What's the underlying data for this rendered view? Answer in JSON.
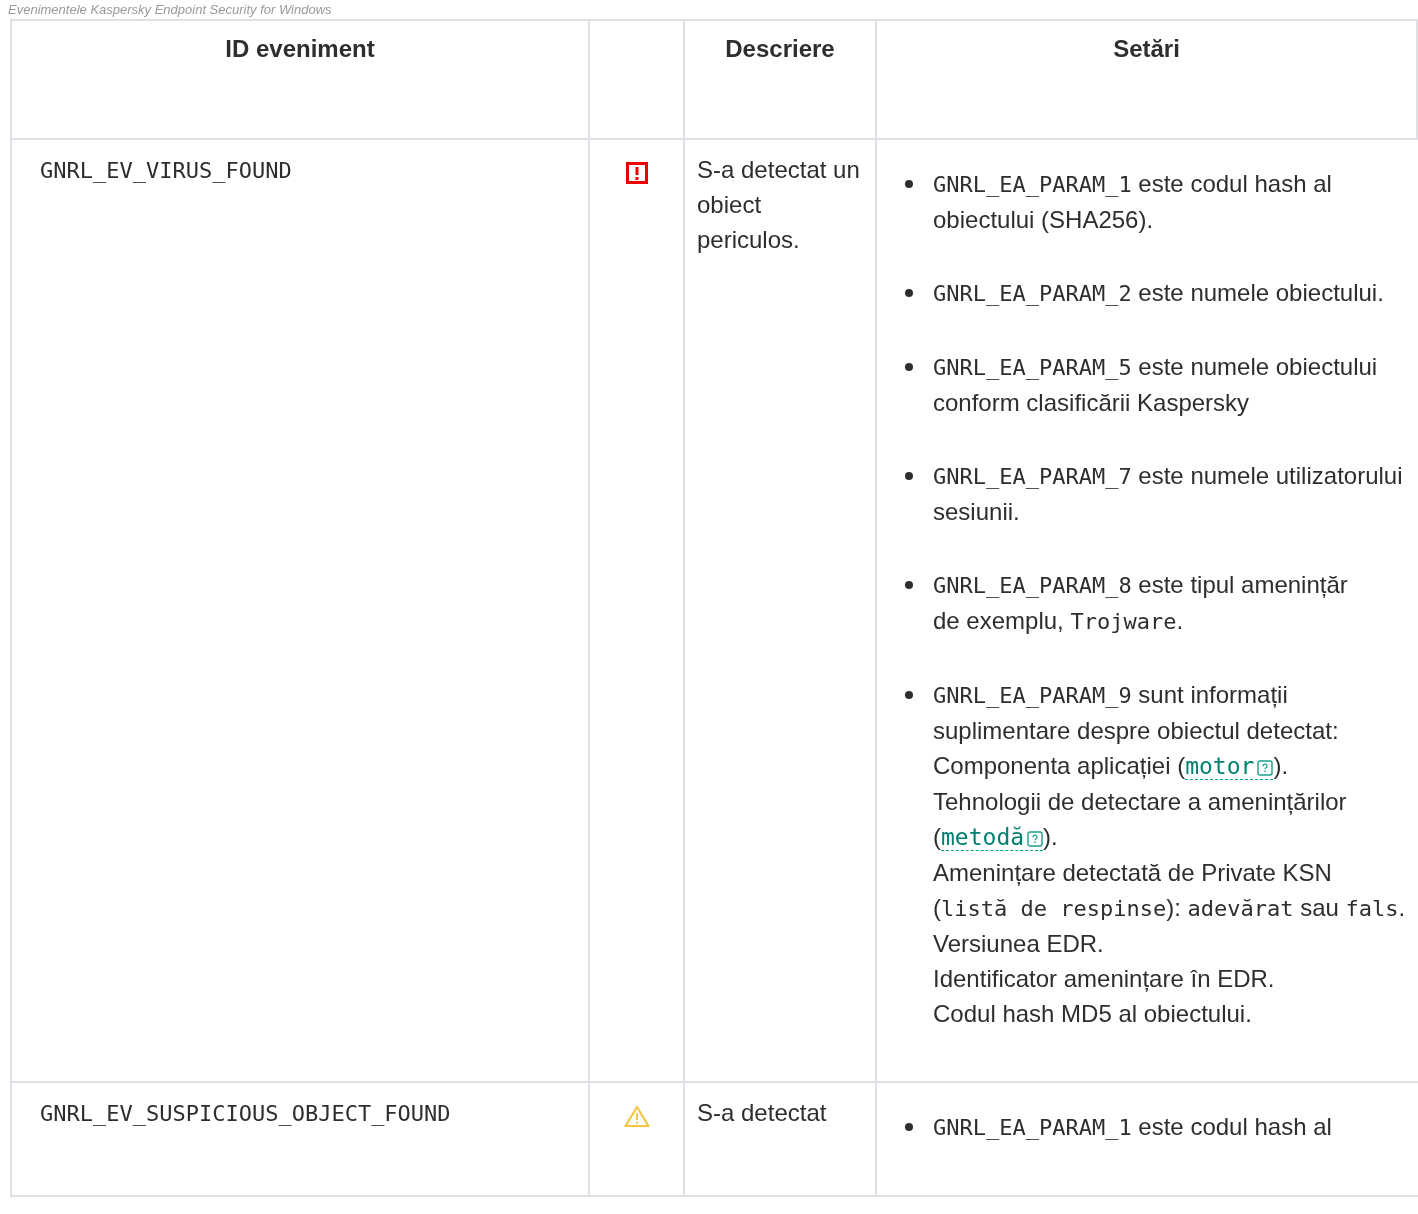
{
  "caption": "Evenimentele Kaspersky Endpoint Security for Windows",
  "table": {
    "columns": [
      "ID eveniment",
      "",
      "Descriere",
      "Setări"
    ],
    "rows": [
      {
        "id": "GNRL_EV_VIRUS_FOUND",
        "kind": "error",
        "description": "S-a detectat un obiect periculos.",
        "settings": [
          [
            {
              "kind": "code",
              "text": "GNRL_EA_PARAM_1"
            },
            {
              "kind": "text",
              "text": " este codul hash al obiectului (SHA256)."
            }
          ],
          [
            {
              "kind": "code",
              "text": "GNRL_EA_PARAM_2"
            },
            {
              "kind": "text",
              "text": " este numele obiectului."
            }
          ],
          [
            {
              "kind": "code",
              "text": "GNRL_EA_PARAM_5"
            },
            {
              "kind": "text",
              "text": " este numele obiectului conform clasificării Kaspersky"
            }
          ],
          [
            {
              "kind": "code",
              "text": "GNRL_EA_PARAM_7"
            },
            {
              "kind": "text",
              "text": " este numele utilizatorului sesiunii."
            }
          ],
          [
            {
              "kind": "code",
              "text": "GNRL_EA_PARAM_8"
            },
            {
              "kind": "text",
              "text": " este tipul amenințăr"
            },
            {
              "kind": "break"
            },
            {
              "kind": "text",
              "text": "de exemplu, "
            },
            {
              "kind": "code",
              "text": "Trojware"
            },
            {
              "kind": "text",
              "text": "."
            }
          ],
          [
            {
              "kind": "code",
              "text": "GNRL_EA_PARAM_9"
            },
            {
              "kind": "text",
              "text": " sunt informații suplimentare despre obiectul detectat: Componenta aplicației ("
            },
            {
              "kind": "link",
              "text": "motor"
            },
            {
              "kind": "text",
              "text": ")."
            },
            {
              "kind": "break"
            },
            {
              "kind": "text",
              "text": "Tehnologii de detectare a amenințărilor ("
            },
            {
              "kind": "link",
              "text": "metodă"
            },
            {
              "kind": "text",
              "text": ")."
            },
            {
              "kind": "break"
            },
            {
              "kind": "text",
              "text": "Amenințare detectată de Private KSN ("
            },
            {
              "kind": "code",
              "text": "listă de respinse"
            },
            {
              "kind": "text",
              "text": "): "
            },
            {
              "kind": "code",
              "text": "adevărat"
            },
            {
              "kind": "text",
              "text": " sau "
            },
            {
              "kind": "code",
              "text": "fals"
            },
            {
              "kind": "text",
              "text": "."
            },
            {
              "kind": "break"
            },
            {
              "kind": "text",
              "text": "Versiunea EDR."
            },
            {
              "kind": "break"
            },
            {
              "kind": "text",
              "text": "Identificator amenințare în EDR."
            },
            {
              "kind": "break"
            },
            {
              "kind": "text",
              "text": "Codul hash MD5 al obiectului."
            }
          ]
        ]
      },
      {
        "id": "GNRL_EV_SUSPICIOUS_OBJECT_FOUND",
        "kind": "warning",
        "description": "S-a detectat",
        "settings": [
          [
            {
              "kind": "code",
              "text": "GNRL_EA_PARAM_1"
            },
            {
              "kind": "text",
              "text": " este codul hash al"
            }
          ]
        ]
      }
    ]
  }
}
